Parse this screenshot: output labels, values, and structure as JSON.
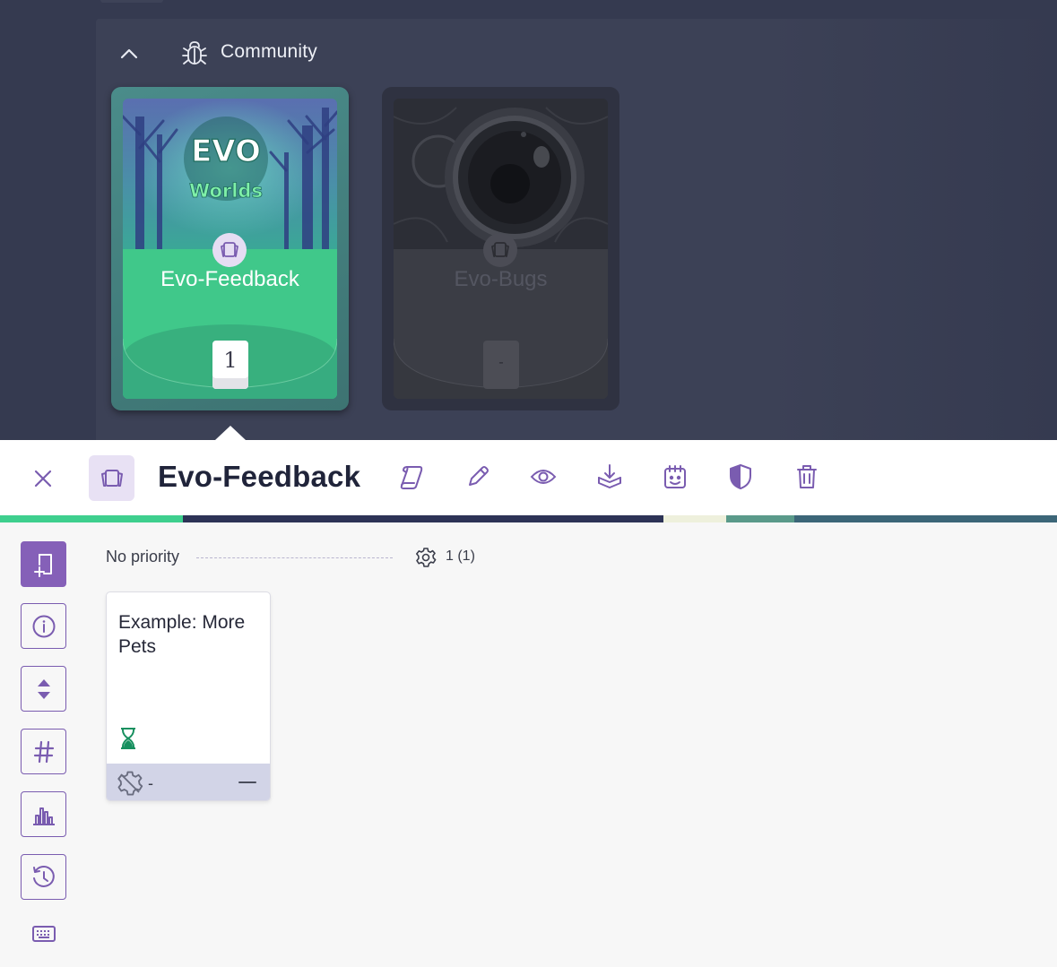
{
  "section": {
    "title": "Community",
    "collapse_icon": "chevron-up-icon",
    "icon": "bug-icon"
  },
  "boards": [
    {
      "name": "Evo-Feedback",
      "count": "1",
      "logo_line1": "EVO",
      "logo_line2": "Worlds",
      "state": "active"
    },
    {
      "name": "Evo-Bugs",
      "count": "-",
      "state": "inactive"
    }
  ],
  "toolbar": {
    "title": "Evo-Feedback",
    "close_icon": "close-icon",
    "board_icon": "board-icon",
    "actions": [
      "scroll-icon",
      "pencil-icon",
      "eye-icon",
      "download-tray-icon",
      "calendar-face-icon",
      "shield-icon",
      "trash-icon"
    ]
  },
  "progress_colors": [
    "#3ecf8e",
    "#2d3356",
    "#eef0dc",
    "#5a9a8a",
    "#3c6678"
  ],
  "rail": [
    "add-ticket-icon",
    "info-icon",
    "sort-icon",
    "hashtag-icon",
    "bar-chart-icon",
    "history-icon",
    "keyboard-icon"
  ],
  "lane": {
    "label": "No priority",
    "count": "1 (1)",
    "effort_icon": "gear-icon"
  },
  "tickets": [
    {
      "title": "Example: More Pets",
      "status_icon": "hourglass-icon",
      "effort": "-",
      "priority_icon": "minus-icon"
    }
  ],
  "colors": {
    "accent": "#7a5cb0",
    "accent_fill": "#8560b8",
    "dark_bg": "#353a50",
    "green": "#3ecf8e"
  }
}
